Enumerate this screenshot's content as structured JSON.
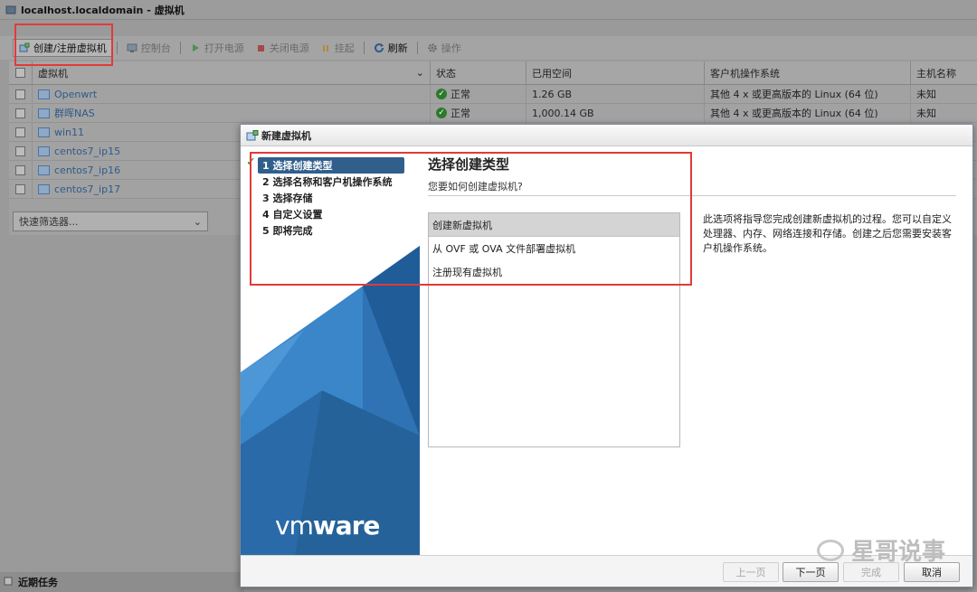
{
  "window": {
    "title": "localhost.localdomain - 虚拟机"
  },
  "toolbar": {
    "create": "创建/注册虚拟机",
    "console": "控制台",
    "power_on": "打开电源",
    "power_off": "关闭电源",
    "suspend": "挂起",
    "refresh": "刷新",
    "actions": "操作"
  },
  "grid": {
    "headers": {
      "name": "虚拟机",
      "state": "状态",
      "space": "已用空间",
      "os": "客户机操作系统",
      "host": "主机名称"
    },
    "rows": [
      {
        "name": "Openwrt",
        "state": "正常",
        "space": "1.26 GB",
        "os": "其他 4 x 或更高版本的 Linux (64 位)",
        "host": "未知"
      },
      {
        "name": "群晖NAS",
        "state": "正常",
        "space": "1,000.14 GB",
        "os": "其他 4 x 或更高版本的 Linux (64 位)",
        "host": "未知"
      },
      {
        "name": "win11"
      },
      {
        "name": "centos7_ip15"
      },
      {
        "name": "centos7_ip16"
      },
      {
        "name": "centos7_ip17"
      }
    ],
    "filter_placeholder": "快速筛选器..."
  },
  "tasks": {
    "label": "近期任务"
  },
  "dialog": {
    "title": "新建虚拟机",
    "steps": [
      "1 选择创建类型",
      "2 选择名称和客户机操作系统",
      "3 选择存储",
      "4 自定义设置",
      "5 即将完成"
    ],
    "heading": "选择创建类型",
    "subheading": "您要如何创建虚拟机?",
    "options": [
      "创建新虚拟机",
      "从 OVF 或 OVA 文件部署虚拟机",
      "注册现有虚拟机"
    ],
    "description": "此选项将指导您完成创建新虚拟机的过程。您可以自定义处理器、内存、网络连接和存储。创建之后您需要安装客户机操作系统。",
    "brand_light": "vm",
    "brand_bold": "ware",
    "buttons": {
      "prev": "上一页",
      "next": "下一页",
      "finish": "完成",
      "cancel": "取消"
    }
  },
  "watermark": "星哥说事",
  "colors": {
    "accent": "#315f8c",
    "annotation": "#e23a3a",
    "ok": "#2b7a2b"
  }
}
